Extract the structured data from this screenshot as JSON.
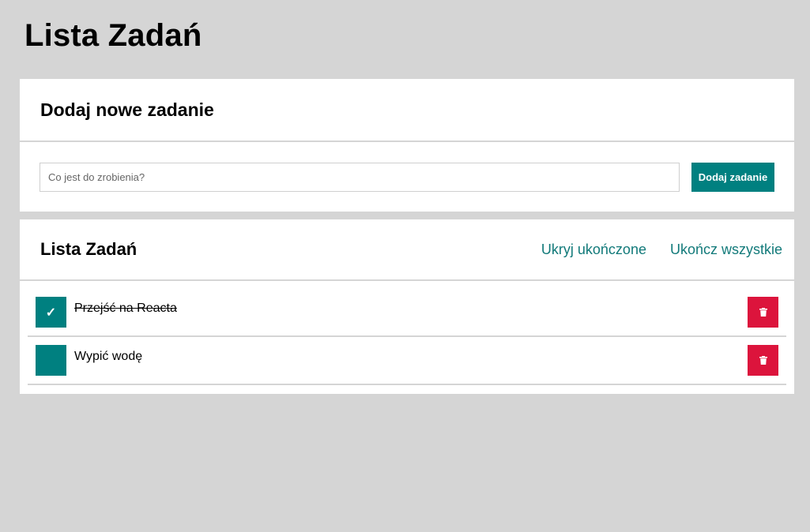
{
  "page": {
    "title": "Lista Zadań"
  },
  "add_panel": {
    "heading": "Dodaj nowe zadanie",
    "input_placeholder": "Co jest do zrobienia?",
    "input_value": "",
    "add_button_label": "Dodaj zadanie"
  },
  "list_panel": {
    "heading": "Lista Zadań",
    "hide_completed_label": "Ukryj ukończone",
    "complete_all_label": "Ukończ wszystkie",
    "tasks": [
      {
        "label": "Przejść na Reacta",
        "completed": true,
        "check_glyph": "✓"
      },
      {
        "label": "Wypić wodę",
        "completed": false,
        "check_glyph": ""
      }
    ]
  },
  "colors": {
    "accent": "#008080",
    "link": "#127a7a",
    "danger": "#dc143c",
    "background": "#d5d5d5"
  },
  "icons": {
    "check": "check-icon",
    "delete": "trash-icon"
  }
}
